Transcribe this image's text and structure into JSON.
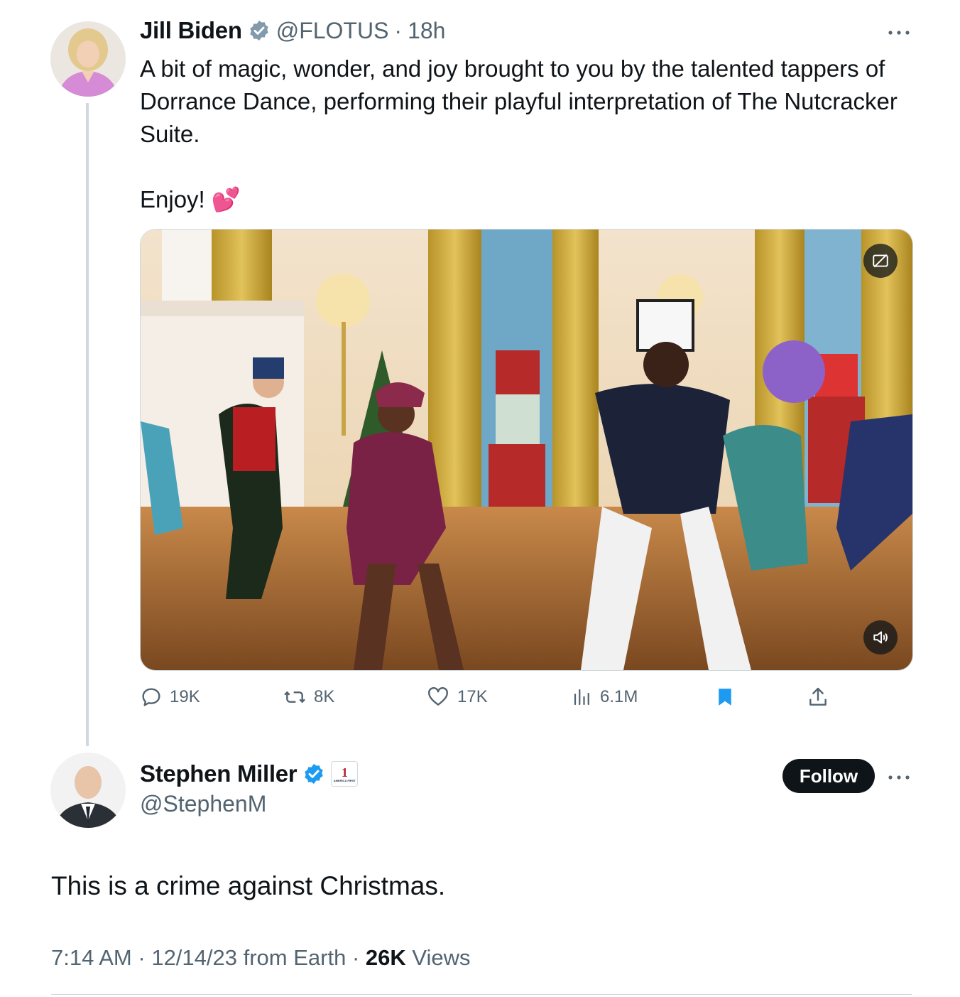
{
  "original_tweet": {
    "author_name": "Jill Biden",
    "handle": "@FLOTUS",
    "separator": "·",
    "time_ago": "18h",
    "text": "A bit of magic, wonder, and joy brought to you by the talented tappers of Dorrance Dance, performing their playful interpretation of The Nutcracker Suite.\n\nEnjoy! 💕",
    "icons": [
      "verified-badge-icon",
      "more-icon",
      "captions-icon",
      "volume-icon"
    ],
    "actions": {
      "replies": "19K",
      "retweets": "8K",
      "likes": "17K",
      "views": "6.1M"
    },
    "bookmark_color": "#1d9bf0"
  },
  "reply_tweet": {
    "author_name": "Stephen Miller",
    "handle": "@StephenM",
    "follow_label": "Follow",
    "text": "This is a crime against Christmas.",
    "time": "7:14 AM",
    "separator": "·",
    "date": "12/14/23 from Earth",
    "views_count": "26K",
    "views_label": "Views",
    "affiliate_badge_number": "1",
    "affiliate_badge_text": "AMERICA FIRST"
  },
  "colors": {
    "text": "#0f1419",
    "muted": "#536471",
    "accent": "#1d9bf0",
    "divider": "#cfd9de"
  }
}
